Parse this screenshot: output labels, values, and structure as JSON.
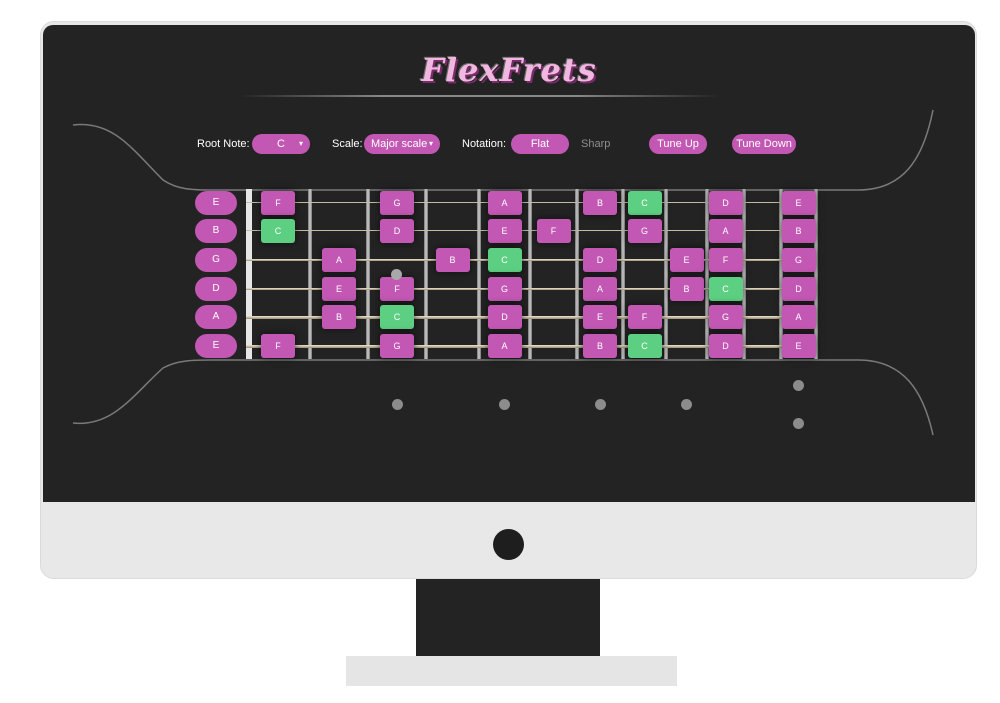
{
  "app": {
    "title": "FlexFrets"
  },
  "controls": {
    "root_label": "Root Note:",
    "root_value": "C",
    "scale_label": "Scale:",
    "scale_value": "Major scale",
    "notation_label": "Notation:",
    "notation_flat": "Flat",
    "notation_sharp": "Sharp",
    "tune_up": "Tune Up",
    "tune_down": "Tune Down",
    "dropdown_caret": "▾"
  },
  "colors": {
    "accent": "#c358b4",
    "root_highlight": "#5dcf82",
    "background": "#232323"
  },
  "tuning": [
    "E",
    "B",
    "G",
    "D",
    "A",
    "E"
  ],
  "fretboard": {
    "strings": [
      {
        "open": "E",
        "notes": [
          {
            "fret": 1,
            "note": "F"
          },
          {
            "fret": 3,
            "note": "G"
          },
          {
            "fret": 5,
            "note": "A"
          },
          {
            "fret": 7,
            "note": "B"
          },
          {
            "fret": 8,
            "note": "C",
            "root": true
          },
          {
            "fret": 10,
            "note": "D"
          },
          {
            "fret": 12,
            "note": "E"
          }
        ]
      },
      {
        "open": "B",
        "notes": [
          {
            "fret": 1,
            "note": "C",
            "root": true
          },
          {
            "fret": 3,
            "note": "D"
          },
          {
            "fret": 5,
            "note": "E"
          },
          {
            "fret": 6,
            "note": "F"
          },
          {
            "fret": 8,
            "note": "G"
          },
          {
            "fret": 10,
            "note": "A"
          },
          {
            "fret": 12,
            "note": "B"
          }
        ]
      },
      {
        "open": "G",
        "notes": [
          {
            "fret": 2,
            "note": "A"
          },
          {
            "fret": 4,
            "note": "B"
          },
          {
            "fret": 5,
            "note": "C",
            "root": true
          },
          {
            "fret": 7,
            "note": "D"
          },
          {
            "fret": 9,
            "note": "E"
          },
          {
            "fret": 10,
            "note": "F"
          },
          {
            "fret": 12,
            "note": "G"
          }
        ]
      },
      {
        "open": "D",
        "notes": [
          {
            "fret": 2,
            "note": "E"
          },
          {
            "fret": 3,
            "note": "F"
          },
          {
            "fret": 5,
            "note": "G"
          },
          {
            "fret": 7,
            "note": "A"
          },
          {
            "fret": 9,
            "note": "B"
          },
          {
            "fret": 10,
            "note": "C",
            "root": true
          },
          {
            "fret": 12,
            "note": "D"
          }
        ]
      },
      {
        "open": "A",
        "notes": [
          {
            "fret": 2,
            "note": "B"
          },
          {
            "fret": 3,
            "note": "C",
            "root": true
          },
          {
            "fret": 5,
            "note": "D"
          },
          {
            "fret": 7,
            "note": "E"
          },
          {
            "fret": 8,
            "note": "F"
          },
          {
            "fret": 10,
            "note": "G"
          },
          {
            "fret": 12,
            "note": "A"
          }
        ]
      },
      {
        "open": "E",
        "notes": [
          {
            "fret": 1,
            "note": "F"
          },
          {
            "fret": 3,
            "note": "G"
          },
          {
            "fret": 5,
            "note": "A"
          },
          {
            "fret": 7,
            "note": "B"
          },
          {
            "fret": 8,
            "note": "C",
            "root": true
          },
          {
            "fret": 10,
            "note": "D"
          },
          {
            "fret": 12,
            "note": "E"
          }
        ]
      }
    ],
    "fret_count": 12,
    "inlay_frets": [
      3,
      5,
      7,
      9,
      12
    ],
    "double_inlay_frets": [
      12
    ]
  }
}
